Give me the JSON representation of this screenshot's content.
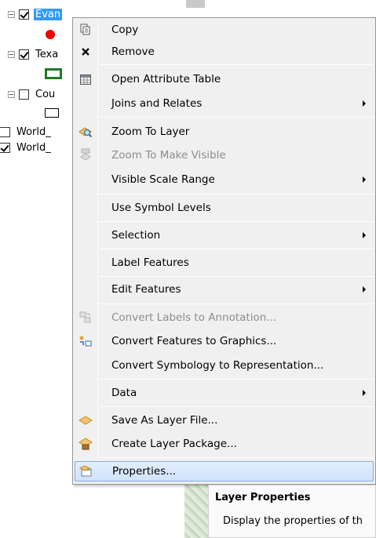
{
  "toc": {
    "layers": [
      {
        "name": "Evan",
        "checked": true,
        "expanded": true,
        "selected": true,
        "symbol": "red-point"
      },
      {
        "name": "Texa",
        "checked": true,
        "expanded": true,
        "selected": false,
        "symbol": "green-polygon"
      },
      {
        "name": "Cou",
        "checked": false,
        "expanded": true,
        "selected": false,
        "symbol": "hollow-polygon"
      },
      {
        "name": "World_",
        "checked": false,
        "expanded": false,
        "selected": false
      },
      {
        "name": "World_",
        "checked": true,
        "expanded": false,
        "selected": false
      }
    ]
  },
  "menu": {
    "items": [
      {
        "label": "Copy",
        "icon": "copy-icon",
        "disabled": false,
        "submenu": false
      },
      {
        "label": "Remove",
        "icon": "remove-icon",
        "disabled": false,
        "submenu": false
      },
      {
        "label": "Open Attribute Table",
        "icon": "table-icon",
        "disabled": false,
        "submenu": false
      },
      {
        "label": "Joins and Relates",
        "icon": "",
        "disabled": false,
        "submenu": true
      },
      {
        "label": "Zoom To Layer",
        "icon": "zoom-layer-icon",
        "disabled": false,
        "submenu": false
      },
      {
        "label": "Zoom To Make Visible",
        "icon": "zoom-visible-icon",
        "disabled": true,
        "submenu": false
      },
      {
        "label": "Visible Scale Range",
        "icon": "",
        "disabled": false,
        "submenu": true
      },
      {
        "label": "Use Symbol Levels",
        "icon": "",
        "disabled": false,
        "submenu": false
      },
      {
        "label": "Selection",
        "icon": "",
        "disabled": false,
        "submenu": true
      },
      {
        "label": "Label Features",
        "icon": "",
        "disabled": false,
        "submenu": false
      },
      {
        "label": "Edit Features",
        "icon": "",
        "disabled": false,
        "submenu": true
      },
      {
        "label": "Convert Labels to Annotation...",
        "icon": "convert-labels-icon",
        "disabled": true,
        "submenu": false
      },
      {
        "label": "Convert Features to Graphics...",
        "icon": "convert-features-icon",
        "disabled": false,
        "submenu": false
      },
      {
        "label": "Convert Symbology to Representation...",
        "icon": "",
        "disabled": false,
        "submenu": false
      },
      {
        "label": "Data",
        "icon": "",
        "disabled": false,
        "submenu": true
      },
      {
        "label": "Save As Layer File...",
        "icon": "layer-file-icon",
        "disabled": false,
        "submenu": false
      },
      {
        "label": "Create Layer Package...",
        "icon": "layer-package-icon",
        "disabled": false,
        "submenu": false
      },
      {
        "label": "Properties...",
        "icon": "properties-icon",
        "disabled": false,
        "submenu": false,
        "highlighted": true
      }
    ]
  },
  "tooltip": {
    "title": "Layer Properties",
    "body": "Display the properties of th"
  },
  "colors": {
    "selection": "#3399ff",
    "highlight_border": "#84acdd",
    "point_symbol": "#ee0000",
    "polygon_outline": "#1f7a1f"
  }
}
